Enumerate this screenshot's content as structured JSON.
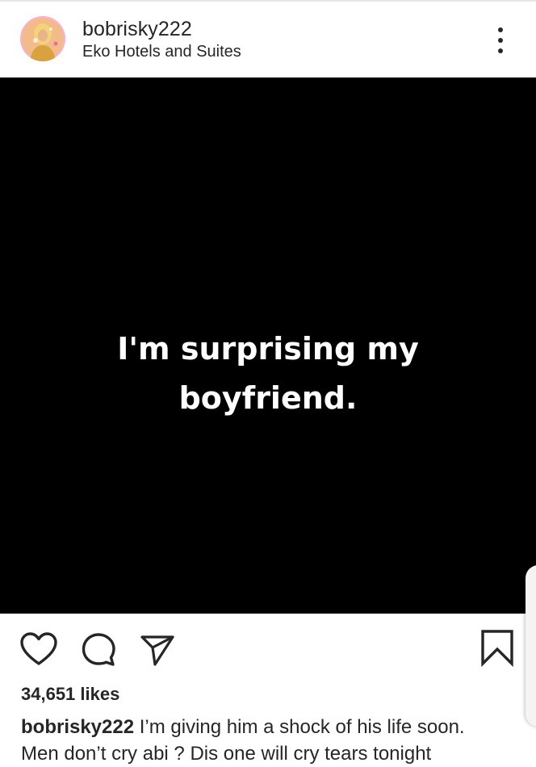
{
  "post": {
    "username": "bobrisky222",
    "location": "Eko Hotels and Suites",
    "image_text": "I'm surprising my boyfriend."
  },
  "icons": {
    "avatar": "profile-photo",
    "more": "more-vertical-icon",
    "like": "heart-icon",
    "comment": "comment-icon",
    "share": "paper-plane-icon",
    "save": "bookmark-icon"
  },
  "engagement": {
    "likes": "34,651 likes"
  },
  "caption": {
    "username": "bobrisky222",
    "line1": "I’m giving him a shock of his life soon.",
    "line2": "Men don’t cry abi ? Dis one will cry tears tonight"
  },
  "colors": {
    "text": "#262626",
    "image_background": "#000000",
    "image_text": "#ffffff"
  }
}
